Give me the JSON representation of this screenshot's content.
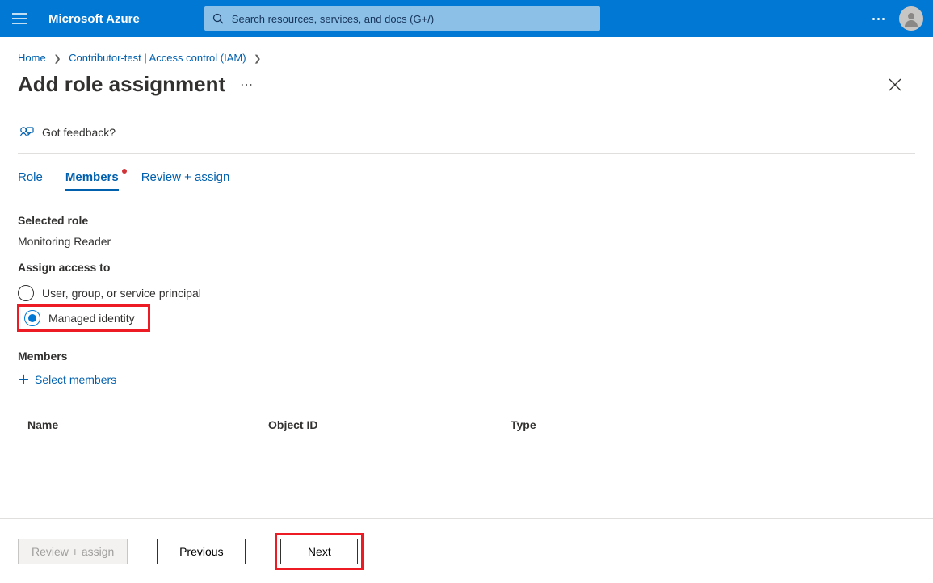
{
  "topbar": {
    "brand": "Microsoft Azure",
    "search_placeholder": "Search resources, services, and docs (G+/)"
  },
  "breadcrumbs": {
    "items": [
      "Home",
      "Contributor-test | Access control (IAM)"
    ]
  },
  "page": {
    "title": "Add role assignment",
    "feedback": "Got feedback?"
  },
  "tabs": {
    "role": "Role",
    "members": "Members",
    "review": "Review + assign"
  },
  "form": {
    "selected_role_label": "Selected role",
    "selected_role_value": "Monitoring Reader",
    "assign_label": "Assign access to",
    "radio_user": "User, group, or service principal",
    "radio_mi": "Managed identity",
    "members_label": "Members",
    "select_members": "Select members"
  },
  "columns": {
    "name": "Name",
    "oid": "Object ID",
    "type": "Type"
  },
  "footer": {
    "review": "Review + assign",
    "previous": "Previous",
    "next": "Next"
  }
}
